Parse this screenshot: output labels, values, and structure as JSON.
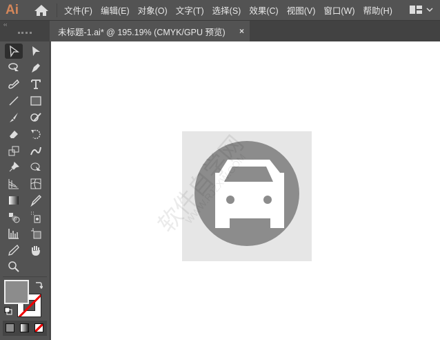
{
  "app": {
    "logo": "Ai"
  },
  "menu": [
    "文件(F)",
    "编辑(E)",
    "对象(O)",
    "文字(T)",
    "选择(S)",
    "效果(C)",
    "视图(V)",
    "窗口(W)",
    "帮助(H)"
  ],
  "tab": {
    "title": "未标题-1.ai* @ 195.19% (CMYK/GPU 预览)",
    "close": "×"
  },
  "panel": {
    "collapse": "‹‹"
  },
  "colors": {
    "ui": "#535353",
    "artboard_bg": "#e6e6e6",
    "circle": "#8c8c8c",
    "car": "#ffffff",
    "logo": "#d5875a"
  },
  "watermark": {
    "text": "软件自学网",
    "url": "WWW.RJZXW.COM"
  }
}
